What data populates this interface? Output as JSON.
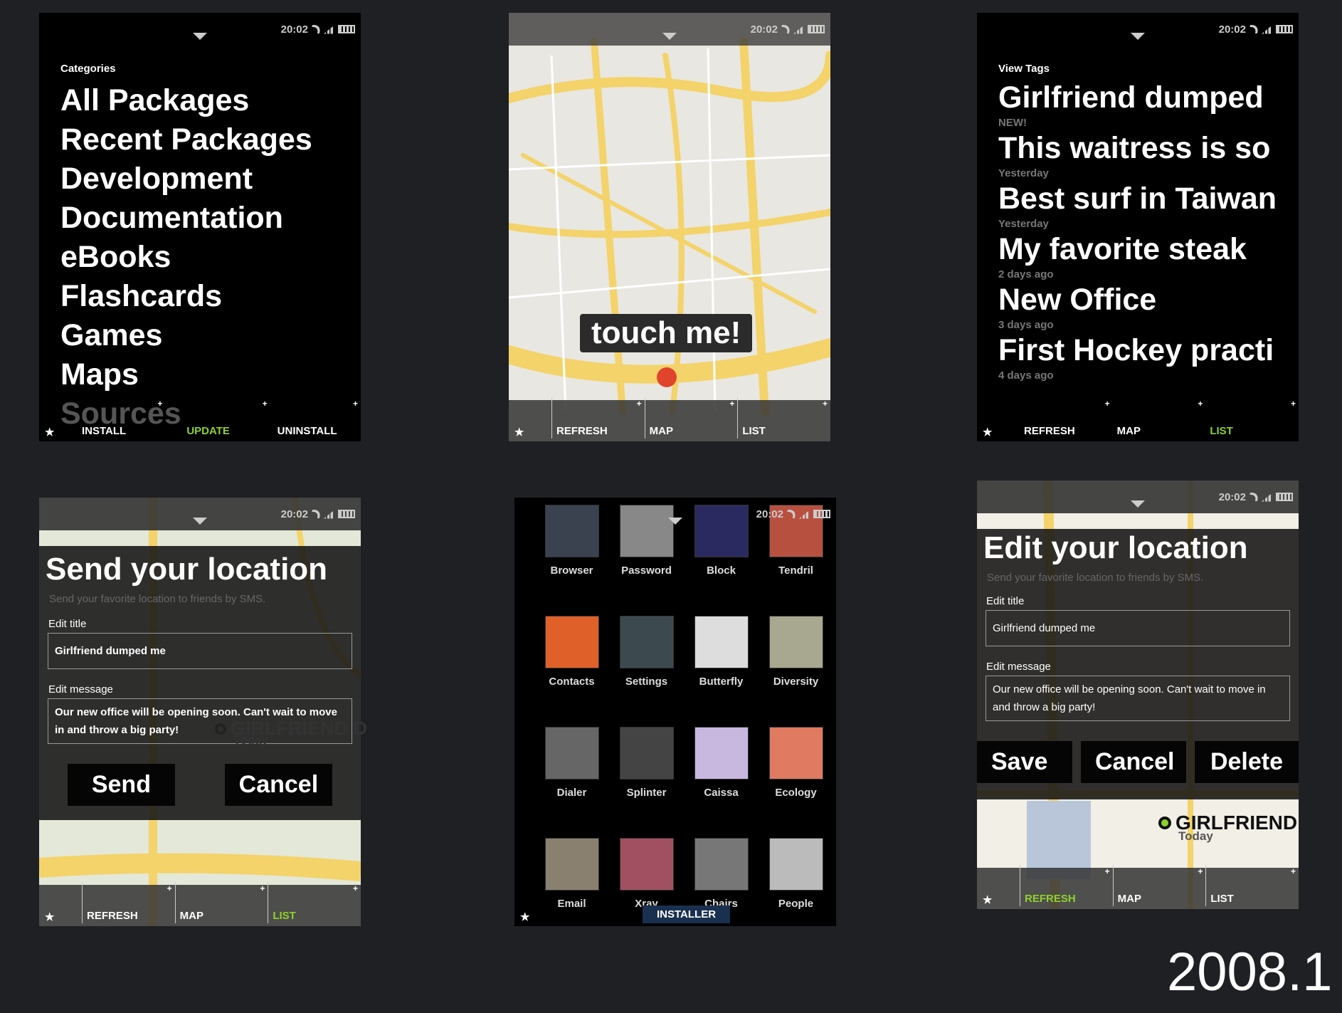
{
  "status": {
    "time": "20:02"
  },
  "categories_screen": {
    "heading": "Categories",
    "items": [
      "All Packages",
      "Recent Packages",
      "Development",
      "Documentation",
      "eBooks",
      "Flashcards",
      "Games",
      "Maps",
      "Sources"
    ],
    "bottom": [
      "INSTALL",
      "UPDATE",
      "UNINSTALL"
    ],
    "active": "UPDATE"
  },
  "map_screen": {
    "bubble": "touch me!",
    "bottom": [
      "REFRESH",
      "MAP",
      "LIST"
    ]
  },
  "tags_screen": {
    "heading": "View Tags",
    "items": [
      {
        "title": "Girlfriend dumped",
        "sub": "NEW!"
      },
      {
        "title": "This waitress is so",
        "sub": "Yesterday"
      },
      {
        "title": "Best surf in Taiwan",
        "sub": "Yesterday"
      },
      {
        "title": "My favorite steak",
        "sub": "2 days ago"
      },
      {
        "title": "New Office",
        "sub": "3 days ago"
      },
      {
        "title": "First Hockey practi",
        "sub": "4 days ago"
      }
    ],
    "bottom": [
      "REFRESH",
      "MAP",
      "LIST"
    ],
    "active": "LIST"
  },
  "send_screen": {
    "title": "Send your location",
    "subtitle": "Send your favorite location to friends by SMS.",
    "title_label": "Edit title",
    "title_value": "Girlfriend dumped me",
    "message_label": "Edit message",
    "message_value": "Our new office will be opening soon. Can't wait to move in and throw a big party!",
    "marker": "GIRLFRIEND D",
    "marker_sub": "Today",
    "buttons": [
      "Send",
      "Cancel"
    ],
    "bottom": [
      "REFRESH",
      "MAP",
      "LIST"
    ],
    "active": "LIST"
  },
  "apps_screen": {
    "apps": [
      "Browser",
      "Password",
      "Block",
      "Tendril",
      "Contacts",
      "Settings",
      "Butterfly",
      "Diversity",
      "Dialer",
      "Splinter",
      "Caissa",
      "Ecology",
      "Email",
      "Xray",
      "Chairs",
      "People"
    ],
    "bottom": "INSTALLER"
  },
  "edit_screen": {
    "title": "Edit your location",
    "subtitle": "Send your favorite location to friends by SMS.",
    "title_label": "Edit title",
    "title_value": "Girlfriend dumped me",
    "message_label": "Edit message",
    "message_value": "Our new office will be opening soon. Can't wait to move in and throw a big party!",
    "marker": "GIRLFRIEND",
    "marker_sub": "Today",
    "buttons": [
      "Save",
      "Cancel",
      "Delete"
    ],
    "bottom": [
      "REFRESH",
      "MAP",
      "LIST"
    ],
    "active": "REFRESH"
  },
  "footer": {
    "version": "2008.1"
  },
  "colors": {
    "accent": "#8fd12c",
    "background": "#1f2023",
    "map_road": "#f3d36a",
    "marker": "#e0442c"
  }
}
